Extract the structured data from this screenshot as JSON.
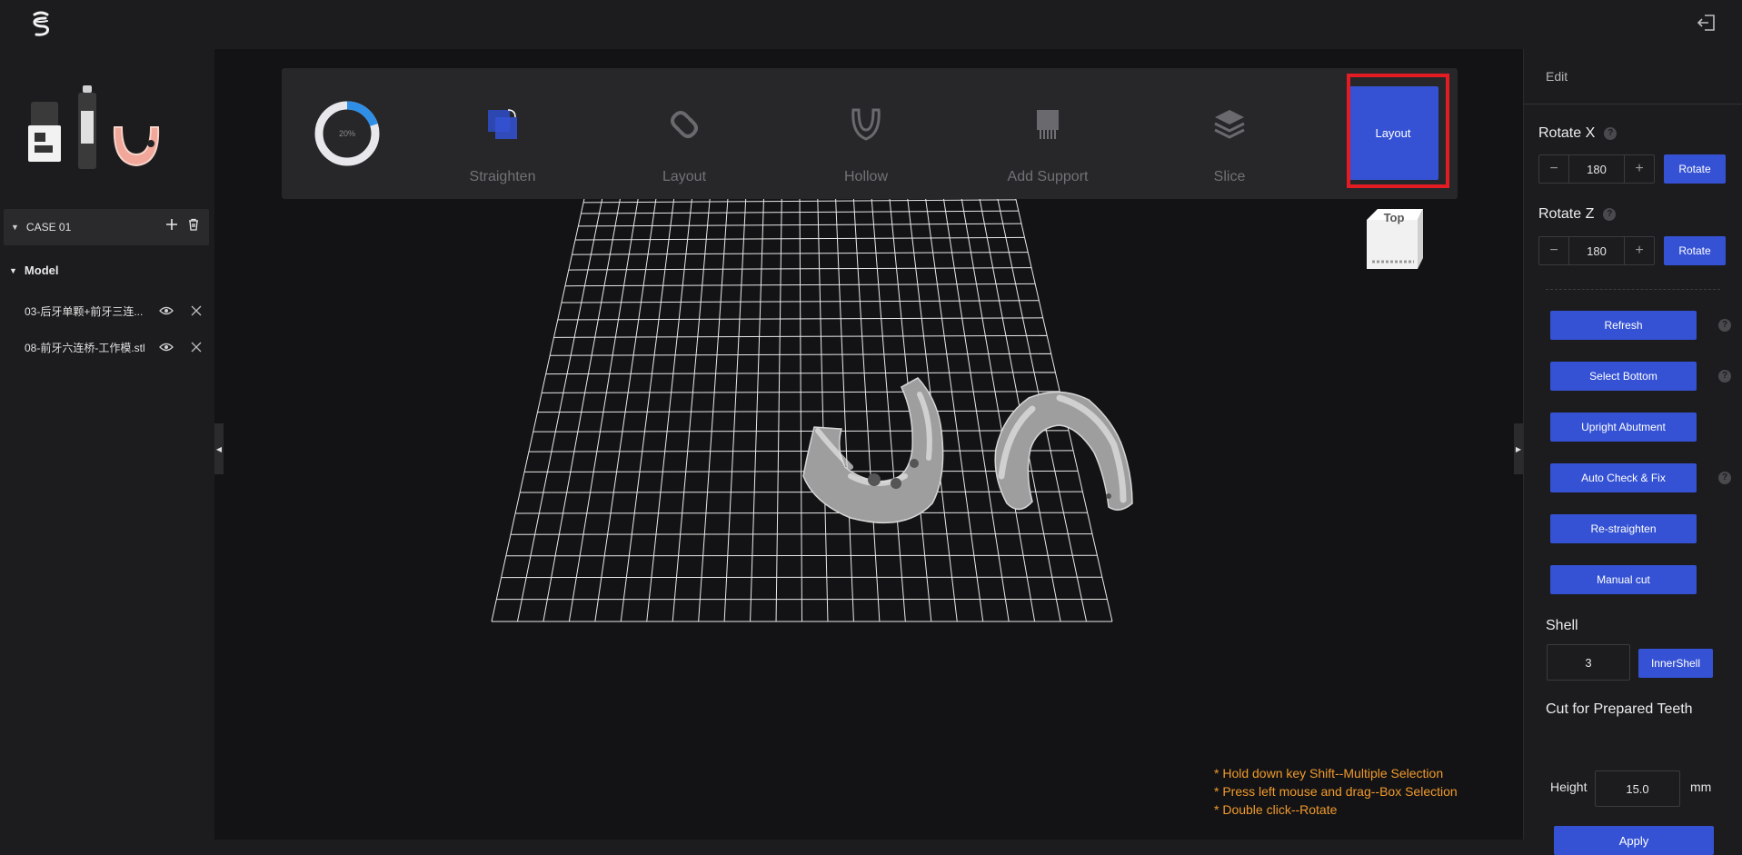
{
  "left": {
    "case": {
      "label": "CASE 01"
    },
    "model_section": {
      "title": "Model"
    },
    "models": [
      {
        "name": "03-后牙单颗+前牙三连..."
      },
      {
        "name": "08-前牙六连桥-工作模.stl"
      }
    ]
  },
  "steps": {
    "progress": {
      "label": "20%",
      "value": 0.2
    },
    "items": [
      {
        "label": "Straighten",
        "icon": "straighten-icon"
      },
      {
        "label": "Layout",
        "icon": "layout-link-icon"
      },
      {
        "label": "Hollow",
        "icon": "hollow-icon"
      },
      {
        "label": "Add Support",
        "icon": "add-support-icon"
      },
      {
        "label": "Slice",
        "icon": "slice-layers-icon"
      }
    ],
    "action_button": "Layout"
  },
  "view_cube": {
    "label": "Top"
  },
  "hints": [
    "* Hold down key Shift--Multiple Selection",
    "* Press left mouse and drag--Box Selection",
    "* Double click--Rotate"
  ],
  "right": {
    "tab": "Edit",
    "rotate_x": {
      "label": "Rotate X",
      "value": "180",
      "button": "Rotate"
    },
    "rotate_z": {
      "label": "Rotate Z",
      "value": "180",
      "button": "Rotate"
    },
    "tools": [
      {
        "label": "Refresh",
        "help": true
      },
      {
        "label": "Select Bottom",
        "help": true
      },
      {
        "label": "Upright Abutment",
        "help": false
      },
      {
        "label": "Auto Check & Fix",
        "help": true
      },
      {
        "label": "Re-straighten",
        "help": false
      },
      {
        "label": "Manual cut",
        "help": false
      }
    ],
    "shell": {
      "label": "Shell",
      "value": "3",
      "button": "InnerShell"
    },
    "cut": {
      "label": "Cut for Prepared Teeth",
      "height_label": "Height",
      "height_value": "15.0",
      "unit": "mm",
      "apply": "Apply"
    }
  },
  "colors": {
    "accent": "#3552d4",
    "highlight": "#e31c23",
    "hint": "#f09a2c"
  }
}
